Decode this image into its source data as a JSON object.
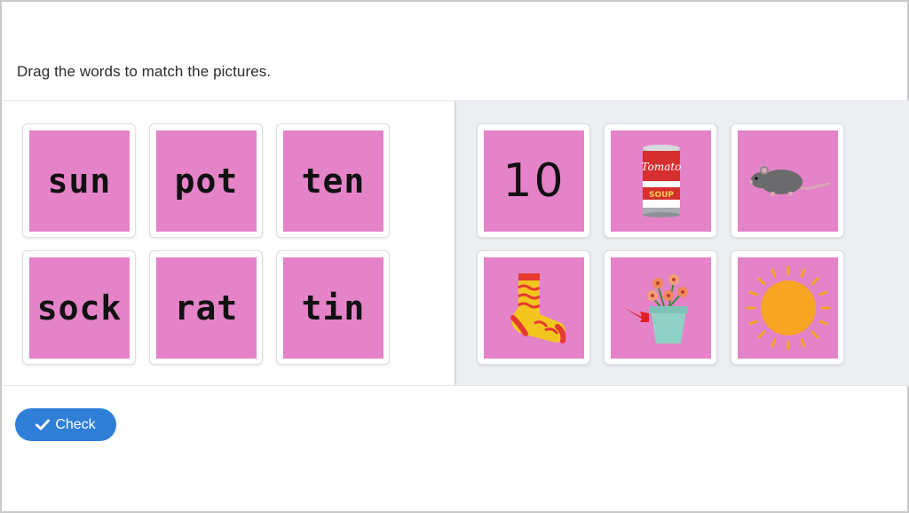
{
  "instruction": "Drag the words to match the pictures.",
  "words": [
    "sun",
    "pot",
    "ten",
    "sock",
    "rat",
    "tin"
  ],
  "pictures": [
    {
      "name": "number-ten-icon",
      "text": "10"
    },
    {
      "name": "tomato-soup-can-icon",
      "text": "Tomato",
      "subtext": "SOUP"
    },
    {
      "name": "rat-icon"
    },
    {
      "name": "sock-icon"
    },
    {
      "name": "flower-pot-icon"
    },
    {
      "name": "sun-icon"
    }
  ],
  "check_button": {
    "label": "Check",
    "icon": "checkmark-icon"
  },
  "colors": {
    "card_fill": "#e483c8",
    "button": "#2f7fd8",
    "pictures_bg": "#eceff2"
  }
}
